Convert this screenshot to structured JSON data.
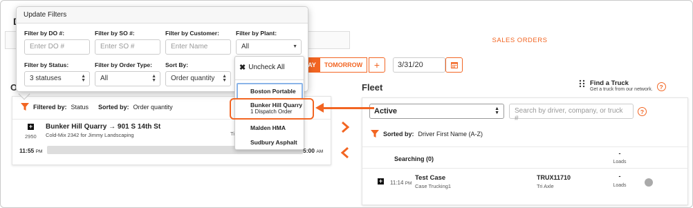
{
  "page": {
    "bg_title": "D"
  },
  "tabs": {
    "sales_orders": "SALES ORDERS"
  },
  "day_buttons": {
    "today_partial": "AY",
    "tomorrow": "TOMORROW",
    "add": "+"
  },
  "date": {
    "value": "3/31/20"
  },
  "orders": {
    "section_label_partial": "O",
    "filtered_by_label": "Filtered by:",
    "filtered_by_value": "Status",
    "sorted_by_label": "Sorted by:",
    "sorted_by_value": "Order quantity",
    "row": {
      "number": "2950",
      "title": "Bunker Hill Quarry → 901 S 14th St",
      "subtitle": "Cold-Mix 2342 for Jimmy Landscaping",
      "ticket_partial": "Tic",
      "start_time": "11:55",
      "start_ampm": "PM",
      "end_time": "5:00",
      "end_ampm": "AM"
    }
  },
  "fleet": {
    "title": "Fleet",
    "find_truck_title": "Find a Truck",
    "find_truck_subtitle": "Get a truck from our network.",
    "status_select": "Active",
    "search_placeholder": "Search by driver, company, or truck #",
    "sorted_by_label": "Sorted by:",
    "sorted_by_value": "Driver First Name (A-Z)",
    "searching_label": "Searching (0)",
    "dash": "-",
    "loads_label": "Loads",
    "truck": {
      "time": "11:14",
      "ampm": "PM",
      "name": "Test Case",
      "company": "Case Trucking1",
      "truck_number": "TRUX11710",
      "truck_type": "Tri Axle"
    }
  },
  "popup": {
    "title": "Update Filters",
    "do_label": "Filter by DO #:",
    "do_placeholder": "Enter DO #",
    "so_label": "Filter by SO #:",
    "so_placeholder": "Enter SO #",
    "customer_label": "Filter by Customer:",
    "customer_placeholder": "Enter Name",
    "plant_label": "Filter by Plant:",
    "plant_value": "All",
    "status_label": "Filter by Status:",
    "status_value": "3 statuses",
    "order_type_label": "Filter by Order Type:",
    "order_type_value": "All",
    "sort_label": "Sort By:",
    "sort_value": "Order quantity"
  },
  "plant_dropdown": {
    "uncheck_all": "Uncheck All",
    "options": [
      {
        "label": "Boston Portable",
        "sub": ""
      },
      {
        "label": "Bunker Hill Quarry",
        "sub": "1 Dispatch Order"
      },
      {
        "label": "Malden HMA",
        "sub": ""
      },
      {
        "label": "Sudbury Asphalt",
        "sub": ""
      }
    ]
  },
  "colors": {
    "accent": "#f26522",
    "highlight": "#8ab4e8"
  }
}
